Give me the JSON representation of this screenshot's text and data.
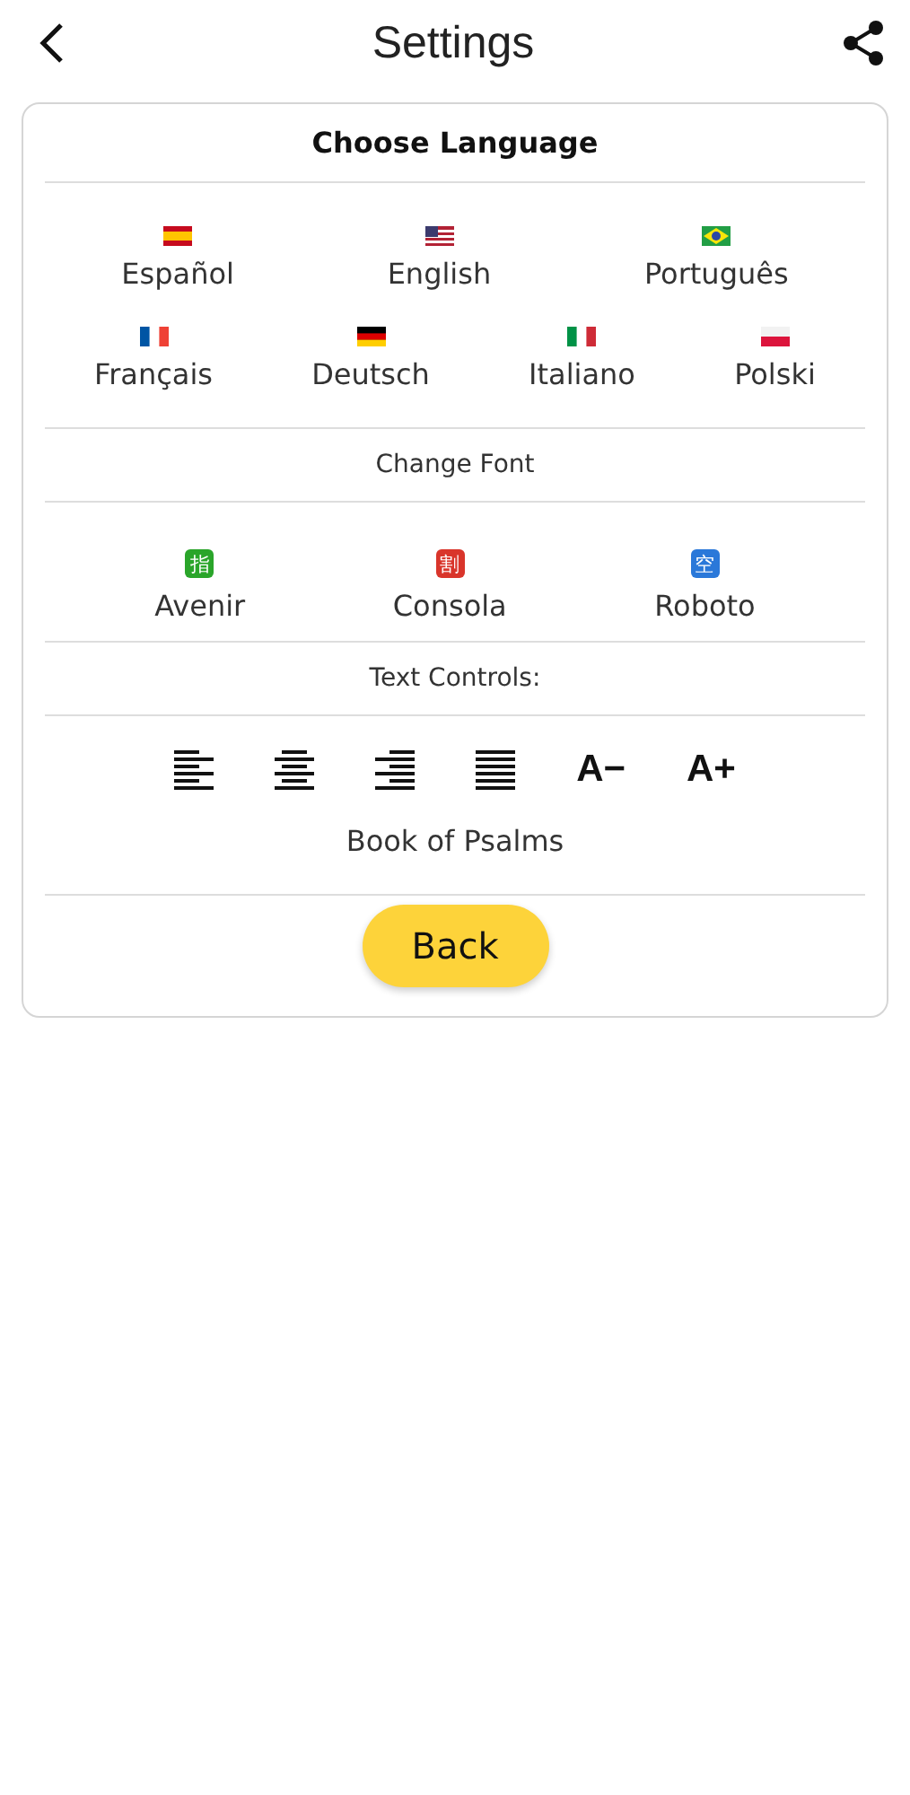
{
  "header": {
    "title": "Settings"
  },
  "language_section": {
    "title": "Choose Language",
    "languages": [
      {
        "label": "Español",
        "kind": "spain"
      },
      {
        "label": "English",
        "kind": "usa"
      },
      {
        "label": "Português",
        "kind": "brazil"
      },
      {
        "label": "Français",
        "kind": "france"
      },
      {
        "label": "Deutsch",
        "kind": "germany"
      },
      {
        "label": "Italiano",
        "kind": "italy"
      },
      {
        "label": "Polski",
        "kind": "poland"
      }
    ]
  },
  "font_section": {
    "title": "Change Font",
    "fonts": [
      {
        "label": "Avenir",
        "badge": "指",
        "color": "#2aa52a"
      },
      {
        "label": "Consola",
        "badge": "割",
        "color": "#d9352b"
      },
      {
        "label": "Roboto",
        "badge": "空",
        "color": "#2a78d9"
      }
    ]
  },
  "text_controls": {
    "title": "Text Controls:",
    "controls": [
      {
        "kind": "left"
      },
      {
        "kind": "center"
      },
      {
        "kind": "right"
      },
      {
        "kind": "justify"
      },
      {
        "kind": "text",
        "label": "A−"
      },
      {
        "kind": "text",
        "label": "A+"
      }
    ],
    "preview": "Book of Psalms"
  },
  "back_button": {
    "label": "Back"
  }
}
